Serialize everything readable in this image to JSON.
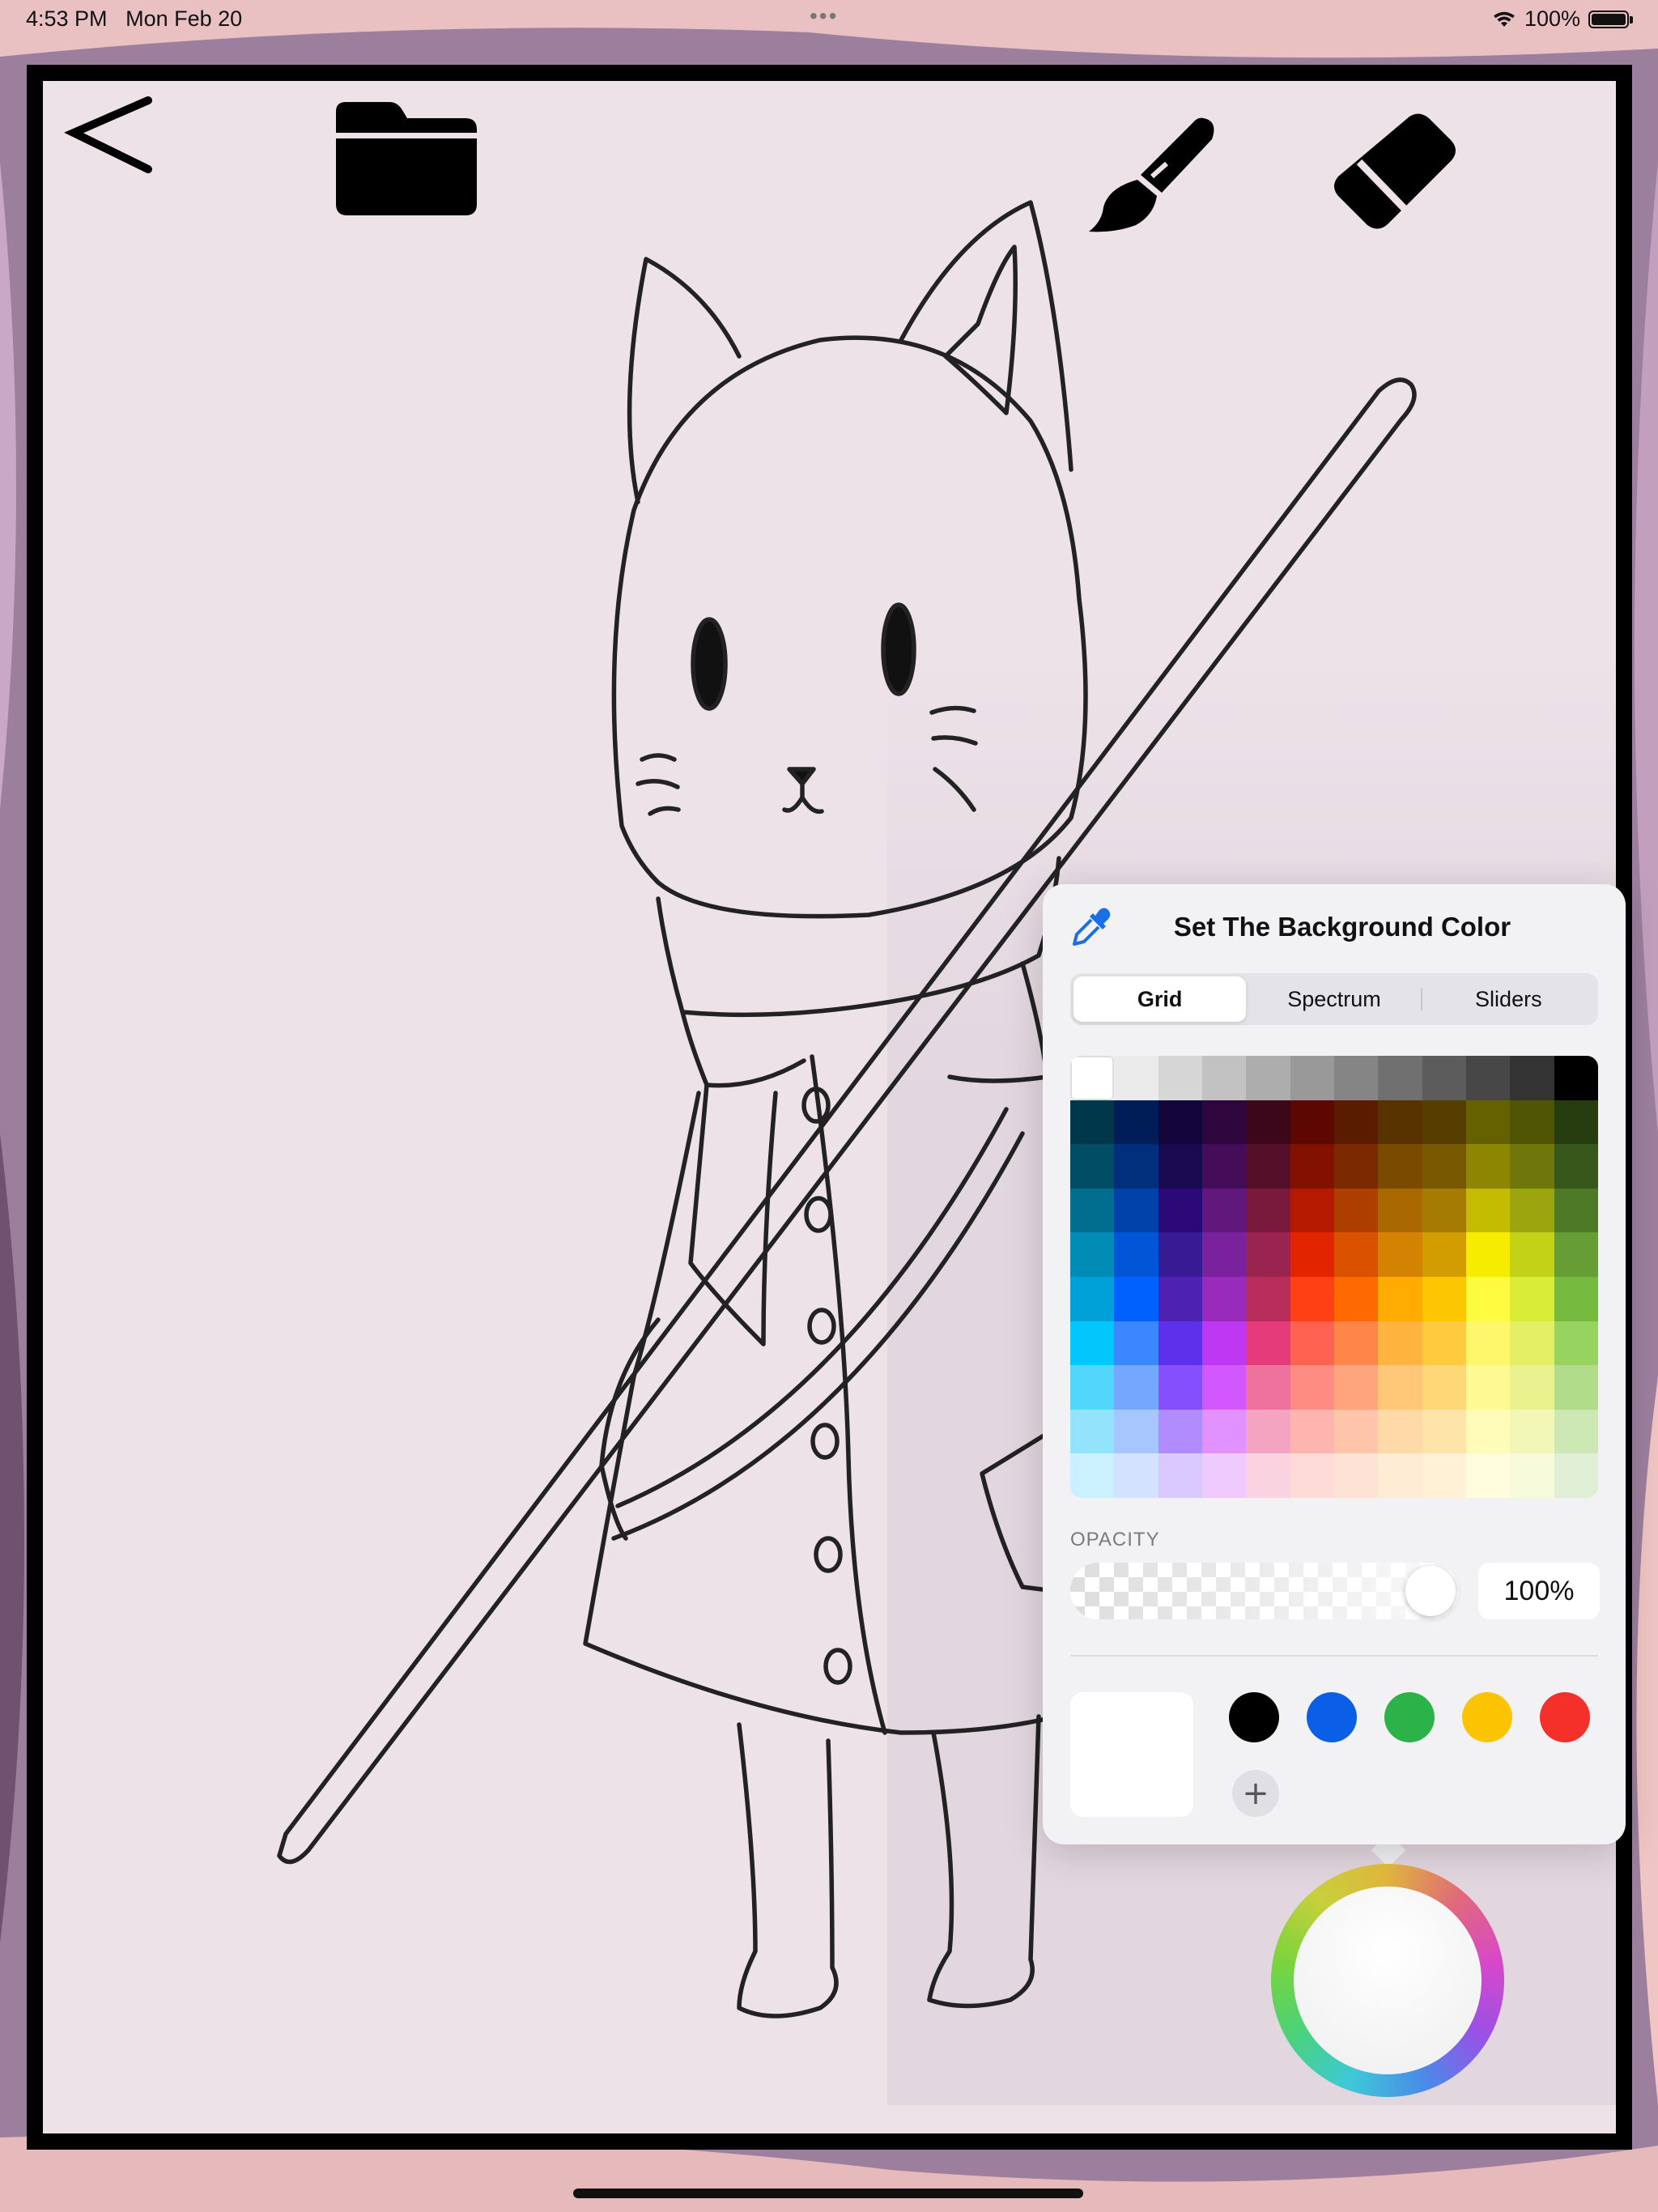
{
  "status_bar": {
    "time": "4:53 PM",
    "date": "Mon Feb 20",
    "multitask": "•••",
    "battery_percent": "100%",
    "battery_level": 1.0,
    "wifi_icon": "wifi-icon"
  },
  "toolbar": {
    "icons": [
      "back-chevron-icon",
      "folder-icon",
      "paintbrush-icon",
      "eraser-icon"
    ]
  },
  "color_picker": {
    "title": "Set The Background Color",
    "eyedropper_icon": "eyedropper-icon",
    "tabs": [
      {
        "label": "Grid",
        "active": true
      },
      {
        "label": "Spectrum",
        "active": false
      },
      {
        "label": "Sliders",
        "active": false
      }
    ],
    "grid_colors": [
      [
        "#ffffff",
        "#ebebeb",
        "#d6d6d6",
        "#c2c2c2",
        "#adadad",
        "#999999",
        "#858585",
        "#707070",
        "#5c5c5c",
        "#474747",
        "#333333",
        "#000000"
      ],
      [
        "#00374a",
        "#011d57",
        "#11053b",
        "#2e063d",
        "#3c071b",
        "#5c0701",
        "#5a1c00",
        "#583300",
        "#563d00",
        "#666100",
        "#4f5504",
        "#263e0f"
      ],
      [
        "#004d65",
        "#012f7b",
        "#1a0a52",
        "#450d59",
        "#551029",
        "#831100",
        "#7b2900",
        "#7a4a00",
        "#785800",
        "#8c8602",
        "#6f760a",
        "#38571a"
      ],
      [
        "#016e8f",
        "#0042a9",
        "#2c0977",
        "#61187c",
        "#791a3d",
        "#b51a00",
        "#ad3e00",
        "#a96800",
        "#a67b01",
        "#c4bc00",
        "#9ba50e",
        "#4e7a27"
      ],
      [
        "#008cb4",
        "#0056d6",
        "#371a94",
        "#7a219e",
        "#99244f",
        "#e22400",
        "#da5100",
        "#d38301",
        "#d19d01",
        "#f5ec00",
        "#c3d117",
        "#669d34"
      ],
      [
        "#00a1d8",
        "#0061fe",
        "#4d22b2",
        "#982abc",
        "#b92d5d",
        "#ff4015",
        "#ff6a00",
        "#ffab01",
        "#fdc700",
        "#fefb41",
        "#d9ec37",
        "#76bb40"
      ],
      [
        "#01c7fc",
        "#3a87fe",
        "#5e30eb",
        "#be38f3",
        "#e63b7a",
        "#ff6250",
        "#ff8648",
        "#feb43f",
        "#fecb3e",
        "#fff76b",
        "#e4ef65",
        "#96d35f"
      ],
      [
        "#52d6fc",
        "#74a7ff",
        "#864ffe",
        "#d357fe",
        "#ee719e",
        "#ff8c82",
        "#ff a57d",
        "#ffc777",
        "#fed877",
        "#fff994",
        "#eaf28f",
        "#b1dd8b"
      ],
      [
        "#93e3fc",
        "#a7c6ff",
        "#b18cfe",
        "#e292fe",
        "#f4a4c0",
        "#ffb5af",
        "#ffc5ab",
        "#ffd9a8",
        "#fee4a8",
        "#fffbb9",
        "#f2f7b7",
        "#cde8b5"
      ],
      [
        "#cbf0ff",
        "#d3e2ff",
        "#d9c9fe",
        "#efcaff",
        "#f9d3e0",
        "#ffdbd8",
        "#ffe2d6",
        "#ffecd4",
        "#fef1d5",
        "#fefcdd",
        "#f7fadb",
        "#dfeed4"
      ]
    ],
    "selected_swatch": "#ffffff",
    "opacity_label": "OPACITY",
    "opacity_fraction": 1.0,
    "opacity_value": "100%",
    "current_color": "#ffffff",
    "favorite_colors": [
      "#000000",
      "#0a5fe6",
      "#2bb34a",
      "#fcc400",
      "#f5302b"
    ],
    "add_favorite_label": "+"
  },
  "color_wheel": {
    "icon": "color-wheel-icon",
    "current_color": "#ffffff"
  }
}
